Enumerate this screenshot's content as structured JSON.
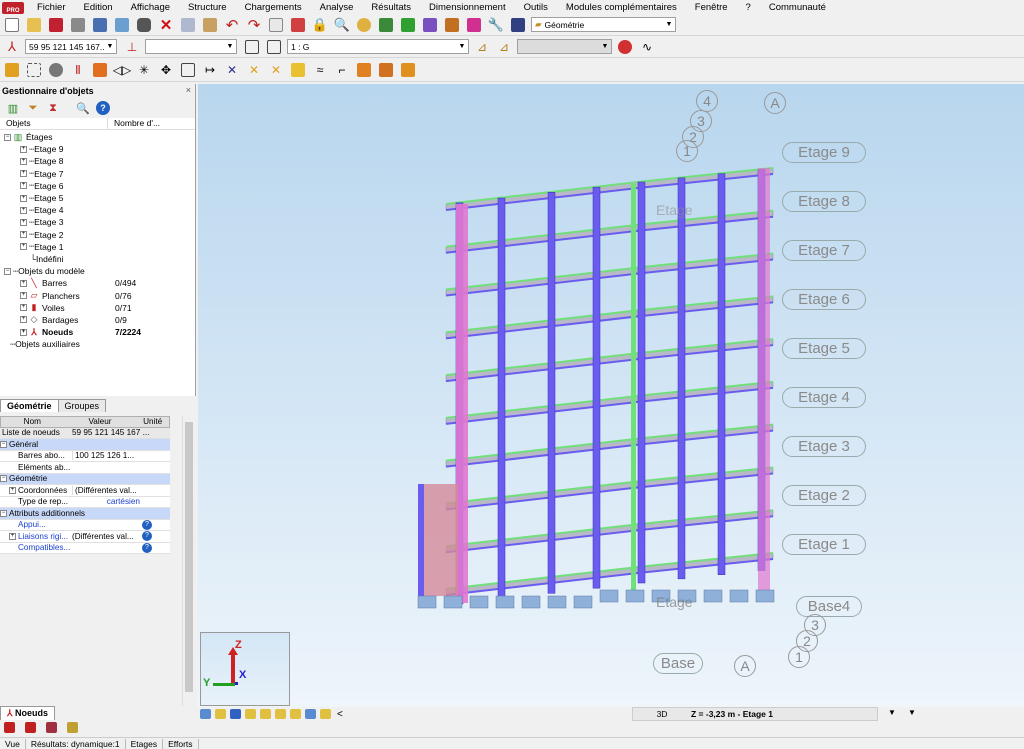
{
  "app": {
    "logo_text": "PRO"
  },
  "menu": [
    "Fichier",
    "Edition",
    "Affichage",
    "Structure",
    "Chargements",
    "Analyse",
    "Résultats",
    "Dimensionnement",
    "Outils",
    "Modules complémentaires",
    "Fenêtre",
    "?",
    "Communauté"
  ],
  "toolbar1": {
    "layout_combo": "Géométrie"
  },
  "toolbar2": {
    "node_list": "59 95 121 145 167...",
    "combo2": "",
    "case_combo": "1 : G",
    "combo4": ""
  },
  "object_manager": {
    "title": "Gestionnaire d'objets",
    "close": "×",
    "columns": [
      "Objets",
      "Nombre d'..."
    ],
    "root_etages": "Étages",
    "etages": [
      "Etage 9",
      "Etage 8",
      "Etage 7",
      "Etage 6",
      "Etage 5",
      "Etage 4",
      "Etage 3",
      "Etage 2",
      "Etage 1"
    ],
    "undefined": "Indéfini",
    "model_objects": "Objets du modèle",
    "model_items": [
      {
        "label": "Barres",
        "count": "0/494"
      },
      {
        "label": "Planchers",
        "count": "0/76"
      },
      {
        "label": "Voiles",
        "count": "0/71"
      },
      {
        "label": "Bardages",
        "count": "0/9"
      },
      {
        "label": "Noeuds",
        "count": "7/2224"
      }
    ],
    "aux_objects": "Objets auxiliaires"
  },
  "tabs": {
    "geometry": "Géométrie",
    "groups": "Groupes"
  },
  "props": {
    "headers": [
      "Nom",
      "Valeur",
      "Unité"
    ],
    "node_list_label": "Liste de noeuds",
    "node_list_value": "59 95 121 145 167 ...",
    "sec_general": "Général",
    "barres_label": "Barres abo...",
    "barres_value": "100 125 126 1...",
    "elements_label": "Eléments ab...",
    "sec_geometry": "Géométrie",
    "coords_label": "Coordonnées",
    "coords_value": "(Différentes val...",
    "reptype_label": "Type de rep...",
    "reptype_value": "cartésien",
    "sec_attrs": "Attributs additionnels",
    "appui_label": "Appui...",
    "liaisons_label": "Liaisons rigi...",
    "liaisons_value": "(Différentes val...",
    "compat_label": "Compatibles..."
  },
  "bottom_tab": "Noeuds",
  "view": {
    "floor_labels": [
      "Etage 9",
      "Etage 8",
      "Etage 7",
      "Etage 6",
      "Etage 5",
      "Etage 4",
      "Etage 3",
      "Etage 2",
      "Etage 1"
    ],
    "base_label": "Base4",
    "grid_top": [
      "4",
      "3",
      "2",
      "1"
    ],
    "grid_A": "A",
    "grid_bottom": [
      "3",
      "2",
      "1"
    ],
    "ghost_floor": "Etage",
    "ghost_base": "Base",
    "axis_z": "Z",
    "axis_x": "X",
    "axis_y": "Y",
    "mode": "3D",
    "z_readout": "Z = -3,23 m - Etage 1",
    "scroll_left": "<"
  },
  "status": [
    "Vue",
    "Résultats: dynamique:1",
    "Etages",
    "Efforts"
  ],
  "colors": {
    "column": "#6a5cf0",
    "beam_green": "#6fe07a",
    "slab": "#b8b8c8",
    "wall_pink": "#e078d0",
    "footing": "#8fb0d8"
  }
}
